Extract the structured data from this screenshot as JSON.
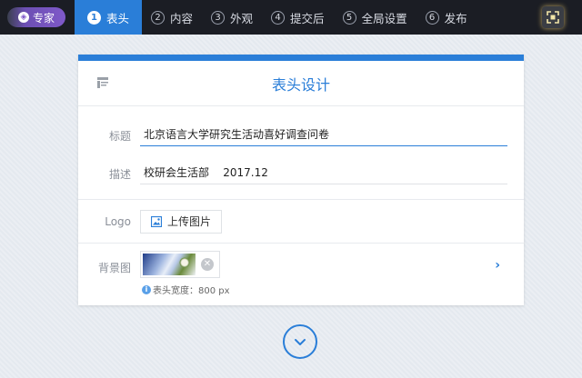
{
  "topbar": {
    "expert_label": "专家",
    "steps": [
      {
        "num": "1",
        "label": "表头"
      },
      {
        "num": "2",
        "label": "内容"
      },
      {
        "num": "3",
        "label": "外观"
      },
      {
        "num": "4",
        "label": "提交后"
      },
      {
        "num": "5",
        "label": "全局设置"
      },
      {
        "num": "6",
        "label": "发布"
      }
    ],
    "active_step": 0,
    "active_color": "#2a7ed8"
  },
  "card": {
    "title": "表头设计",
    "title_label": "标题",
    "title_value": "北京语言大学研究生活动喜好调查问卷",
    "desc_label": "描述",
    "desc_value": "校研会生活部    2017.12",
    "logo_label": "Logo",
    "upload_label": "上传图片",
    "bg_label": "背景图",
    "hint_text": "表头宽度：800 px"
  },
  "icons": {
    "layout": "layout-icon",
    "image": "image-icon",
    "clear": "clear-icon",
    "info": "info-icon",
    "chevron_right": "chevron-right-icon",
    "chevron_down": "chevron-down-icon",
    "fullscreen": "fullscreen-icon"
  }
}
